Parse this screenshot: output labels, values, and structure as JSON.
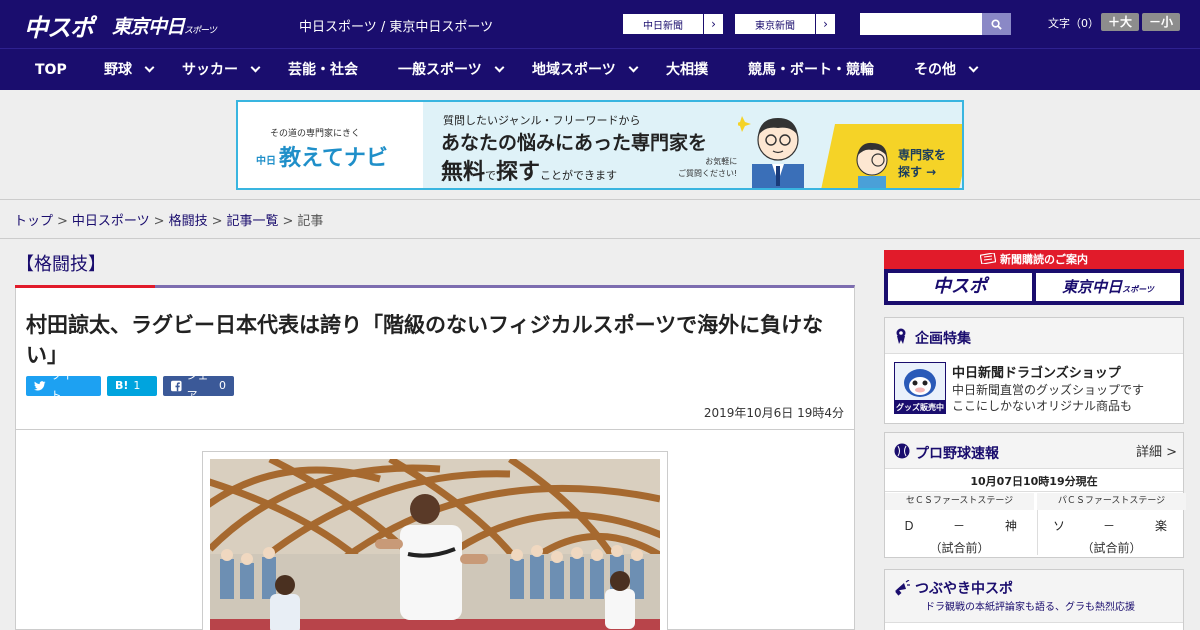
{
  "header": {
    "logo_chunichi": "中スポ",
    "logo_tokyo": "東京中日",
    "logo_tokyo_small": "スポーツ",
    "site_title": "中日スポーツ / 東京中日スポーツ",
    "links": [
      {
        "label": "中日新聞",
        "arrow": "›"
      },
      {
        "label": "東京新聞",
        "arrow": "›"
      }
    ],
    "search_placeholder": "",
    "fontsize_label": "文字（0）",
    "fontsize_larger": "＋大",
    "fontsize_smaller": "－小"
  },
  "nav": {
    "items": [
      {
        "label": "TOP",
        "dropdown": false
      },
      {
        "label": "野球",
        "dropdown": true
      },
      {
        "label": "サッカー",
        "dropdown": true
      },
      {
        "label": "芸能・社会",
        "dropdown": false
      },
      {
        "label": "一般スポーツ",
        "dropdown": true
      },
      {
        "label": "地域スポーツ",
        "dropdown": true
      },
      {
        "label": "大相撲",
        "dropdown": false
      },
      {
        "label": "競馬・ボート・競輪",
        "dropdown": false
      },
      {
        "label": "その他",
        "dropdown": true
      }
    ]
  },
  "banner": {
    "tagline": "その道の専門家にきく",
    "brand_prefix": "中日",
    "brand": "教えてナビ",
    "line1": "質問したいジャンル・フリーワードから",
    "line2": "あなたの悩みにあった専門家を",
    "line3_a": "無料",
    "line3_b": "で",
    "line3_c": "探す",
    "line3_d": "ことができます",
    "note1": "お気軽に",
    "note2": "ご質問ください!",
    "cta1": "専門家を",
    "cta2": "探す →"
  },
  "breadcrumb": [
    "トップ",
    "中日スポーツ",
    "格闘技",
    "記事一覧",
    "記事"
  ],
  "article": {
    "category": "【格闘技】",
    "headline": "村田諒太、ラグビー日本代表は誇り「階級のないフィジカルスポーツで海外に負けない」",
    "share": {
      "tweet": "ツイート",
      "hatena_icon": "B!",
      "hatena_count": "1",
      "facebook": "シェア",
      "facebook_count": "0"
    },
    "pubdate": "2019年10月6日 19時4分"
  },
  "sidebar": {
    "subscribe_head": "新聞購読のご案内",
    "subscribe_logo1": "中スポ",
    "subscribe_logo2": "東京中日",
    "subscribe_logo2_small": "スポーツ",
    "kikaku": {
      "title": "企画特集",
      "item_title": "中日新聞ドラゴンズショップ",
      "item_desc1": "中日新聞直営のグッズショップです",
      "item_desc2": "ここにしかないオリジナル商品も",
      "thumb_label": "グッズ販売中"
    },
    "score": {
      "title": "プロ野球速報",
      "detail": "詳細 >",
      "date": "10月07日10時19分現在",
      "games": [
        {
          "stage": "セＣＳファーストステージ",
          "home": "Ｄ",
          "dash": "－",
          "away": "神",
          "status": "（試合前）"
        },
        {
          "stage": "パＣＳファーストステージ",
          "home": "ソ",
          "dash": "－",
          "away": "楽",
          "status": "（試合前）"
        }
      ]
    },
    "tsubuyaki": {
      "title": "つぶやき中スポ",
      "sub": "ドラ観戦の本紙評論家も語る、グラも熱烈応援"
    }
  },
  "colors": {
    "brand_navy": "#1a0d6e",
    "accent_red": "#e11b2a",
    "twitter": "#1da1f2",
    "hatena": "#00a4de",
    "facebook": "#3b5998"
  }
}
